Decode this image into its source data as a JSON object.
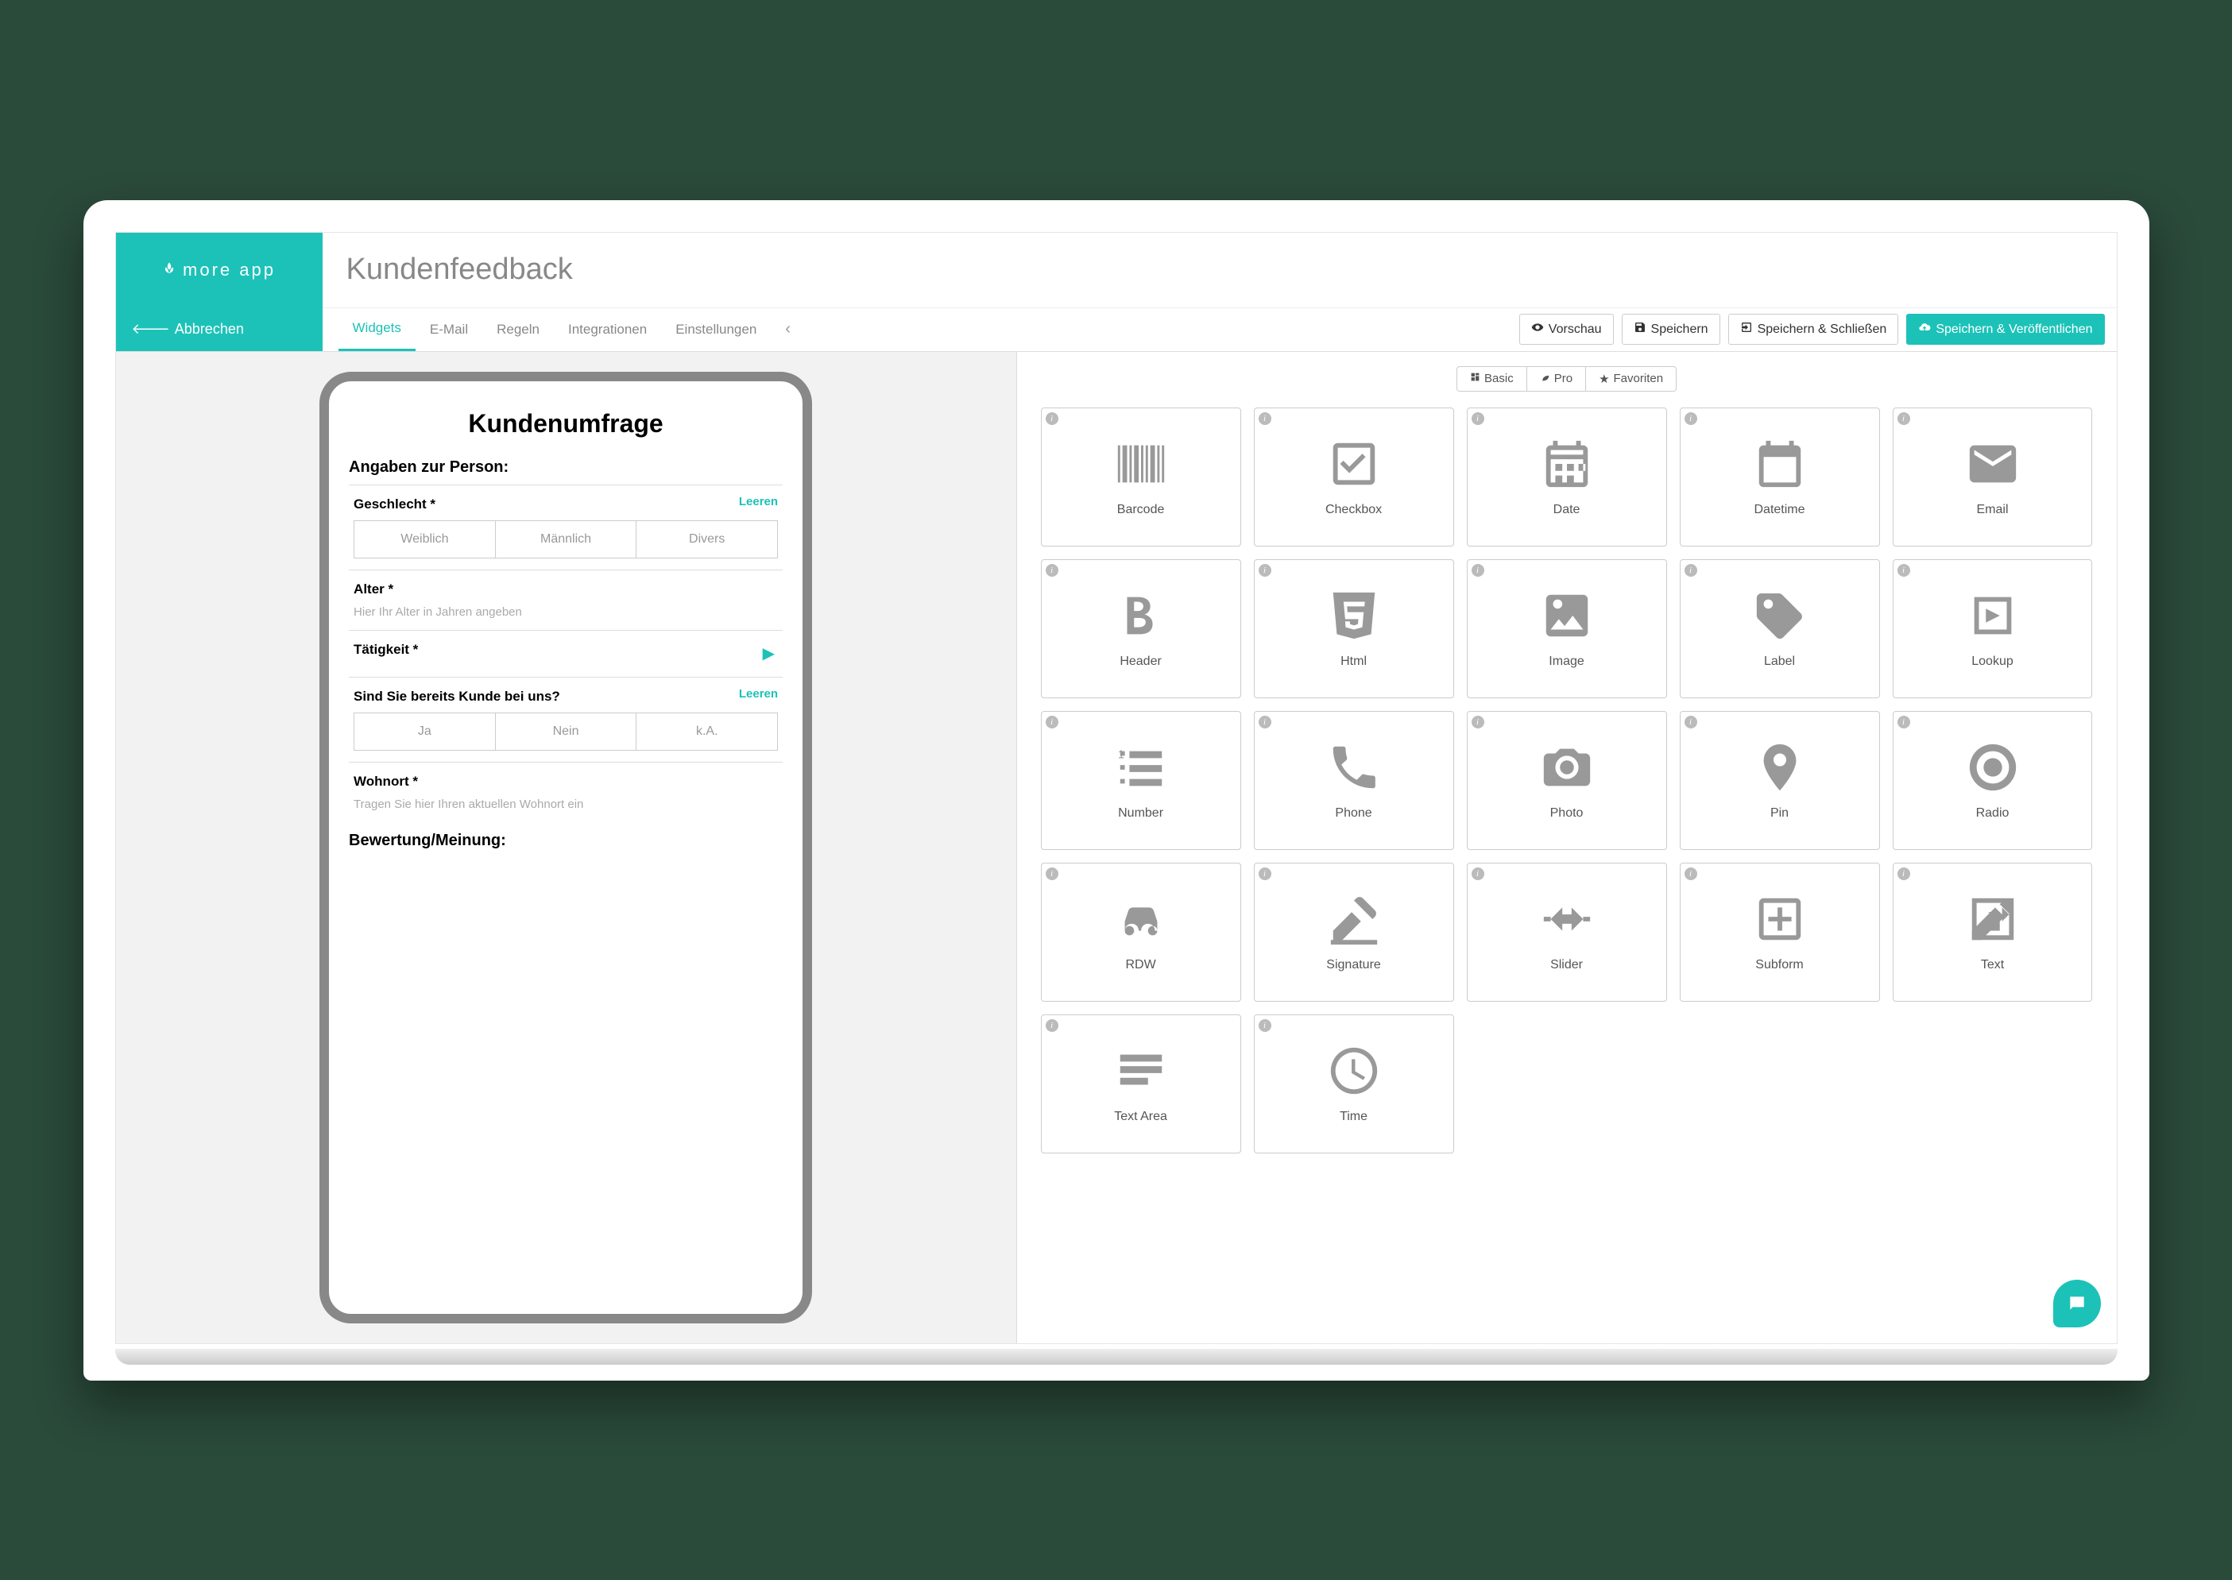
{
  "brand": "more app",
  "pageTitle": "Kundenfeedback",
  "cancel": "Abbrechen",
  "tabs": [
    "Widgets",
    "E-Mail",
    "Regeln",
    "Integrationen",
    "Einstellungen"
  ],
  "actions": {
    "preview": "Vorschau",
    "save": "Speichern",
    "saveClose": "Speichern & Schließen",
    "savePublish": "Speichern & Veröffentlichen"
  },
  "form": {
    "title": "Kundenumfrage",
    "section1": "Angaben zur Person:",
    "clear": "Leeren",
    "gender": {
      "label": "Geschlecht *",
      "options": [
        "Weiblich",
        "Männlich",
        "Divers"
      ]
    },
    "age": {
      "label": "Alter *",
      "placeholder": "Hier Ihr Alter in Jahren angeben"
    },
    "job": {
      "label": "Tätigkeit *"
    },
    "customer": {
      "label": "Sind Sie bereits Kunde bei uns?",
      "options": [
        "Ja",
        "Nein",
        "k.A."
      ]
    },
    "location": {
      "label": "Wohnort *",
      "placeholder": "Tragen Sie hier Ihren aktuellen Wohnort ein"
    },
    "section2": "Bewertung/Meinung:"
  },
  "widgetCats": [
    "Basic",
    "Pro",
    "Favoriten"
  ],
  "widgets": [
    {
      "id": "barcode",
      "label": "Barcode"
    },
    {
      "id": "checkbox",
      "label": "Checkbox"
    },
    {
      "id": "date",
      "label": "Date"
    },
    {
      "id": "datetime",
      "label": "Datetime"
    },
    {
      "id": "email",
      "label": "Email"
    },
    {
      "id": "header",
      "label": "Header"
    },
    {
      "id": "html",
      "label": "Html"
    },
    {
      "id": "image",
      "label": "Image"
    },
    {
      "id": "label",
      "label": "Label"
    },
    {
      "id": "lookup",
      "label": "Lookup"
    },
    {
      "id": "number",
      "label": "Number"
    },
    {
      "id": "phone",
      "label": "Phone"
    },
    {
      "id": "photo",
      "label": "Photo"
    },
    {
      "id": "pin",
      "label": "Pin"
    },
    {
      "id": "radio",
      "label": "Radio"
    },
    {
      "id": "rdw",
      "label": "RDW"
    },
    {
      "id": "signature",
      "label": "Signature"
    },
    {
      "id": "slider",
      "label": "Slider"
    },
    {
      "id": "subform",
      "label": "Subform"
    },
    {
      "id": "text",
      "label": "Text"
    },
    {
      "id": "textarea",
      "label": "Text Area"
    },
    {
      "id": "time",
      "label": "Time"
    }
  ]
}
